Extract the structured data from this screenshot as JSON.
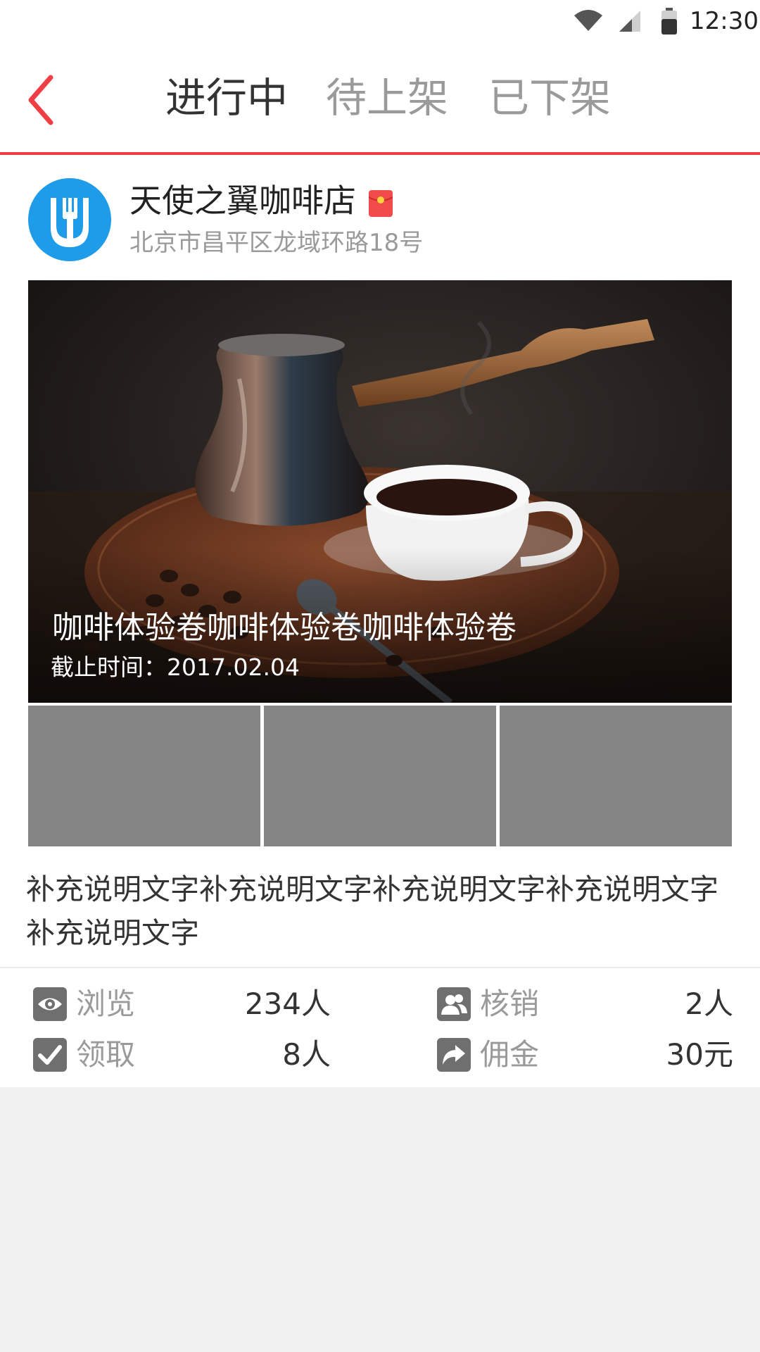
{
  "status_bar": {
    "time": "12:30",
    "icons": [
      "wifi-icon",
      "signal-icon",
      "battery-icon"
    ]
  },
  "header": {
    "back_icon": "chevron-left-icon",
    "tabs": [
      {
        "label": "进行中",
        "active": true
      },
      {
        "label": "待上架",
        "active": false
      },
      {
        "label": "已下架",
        "active": false
      }
    ]
  },
  "shop": {
    "name": "天使之翼咖啡店",
    "address": "北京市昌平区龙域环路18号",
    "avatar_icon": "fork-shield-icon",
    "badge_icon": "red-packet-icon"
  },
  "coupon": {
    "title": "咖啡体验卷咖啡体验卷咖啡体验卷",
    "deadline": "截止时间：2017.02.04"
  },
  "description": "补充说明文字补充说明文字补充说明文字补充说明文字补充说明文字",
  "stats": {
    "views": {
      "label": "浏览",
      "value": "234人",
      "icon": "eye-icon"
    },
    "claims": {
      "label": "领取",
      "value": "8人",
      "icon": "checkbox-icon"
    },
    "redeemed": {
      "label": "核销",
      "value": "2人",
      "icon": "users-icon"
    },
    "commission": {
      "label": "佣金",
      "value": "30元",
      "icon": "share-arrow-icon"
    }
  },
  "colors": {
    "accent": "#ef3e44",
    "avatar_bg": "#1e9be9",
    "thumbnail_placeholder": "#858585",
    "page_bg": "#f0f0f0"
  }
}
